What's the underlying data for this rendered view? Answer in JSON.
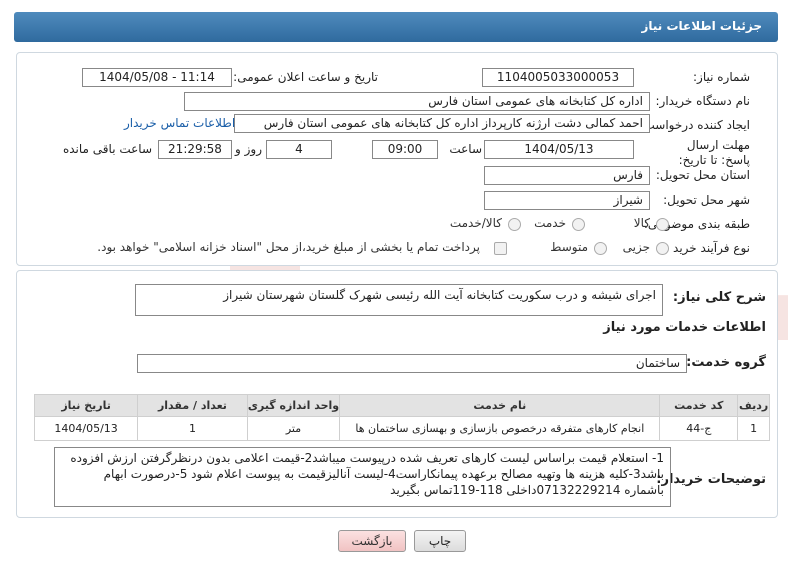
{
  "header": {
    "title": "جزئیات اطلاعات نیاز"
  },
  "fields": {
    "need_number_label": "شماره نیاز:",
    "need_number": "1104005033000053",
    "announce_label": "تاریخ و ساعت اعلان عمومی:",
    "announce_value": "1404/05/08 - 11:14",
    "buyer_label": "نام دستگاه خریدار:",
    "buyer_value": "اداره کل کتابخانه های عمومی استان فارس",
    "creator_label": "ایجاد کننده درخواست:",
    "creator_value": "احمد  کمالی دشت ارژنه  کارپرداز اداره کل کتابخانه های عمومی استان فارس",
    "buyer_contact_link": "اطلاعات تماس خریدار",
    "deadline_label": "مهلت ارسال پاسخ: تا تاریخ:",
    "deadline_date": "1404/05/13",
    "time_label": "ساعت",
    "deadline_time": "09:00",
    "days_value": "4",
    "days_label": "روز و",
    "remaining_time": "21:29:58",
    "remaining_label": "ساعت باقی مانده",
    "province_label": "استان محل تحویل:",
    "province_value": "فارس",
    "city_label": "شهر محل تحویل:",
    "city_value": "شیراز",
    "category_label": "طبقه بندی موضوعی:",
    "category_options": [
      "کالا",
      "خدمت",
      "کالا/خدمت"
    ],
    "purchase_type_label": "نوع فرآیند خرید :",
    "purchase_options": [
      "جزیی",
      "متوسط"
    ],
    "payment_note": "پرداخت تمام یا بخشی از مبلغ خرید،از محل \"اسناد خزانه اسلامی\" خواهد بود."
  },
  "section2": {
    "summary_label": "شرح کلی نیاز:",
    "summary_value": "اجرای شیشه و درب سکوریت کتابخانه آیت الله رئیسی شهرک گلستان شهرستان شیراز",
    "services_title": "اطلاعات خدمات مورد نیاز",
    "service_group_label": "گروه خدمت:",
    "service_group_value": "ساختمان"
  },
  "table": {
    "headers": [
      "ردیف",
      "کد خدمت",
      "نام خدمت",
      "واحد اندازه گیری",
      "تعداد / مقدار",
      "تاریخ نیاز"
    ],
    "rows": [
      [
        "1",
        "ج-44",
        "انجام کارهای متفرقه درخصوص بازسازی و بهسازی ساختمان ها",
        "متر",
        "1",
        "1404/05/13"
      ]
    ]
  },
  "notes": {
    "label": "توضیحات خریدار:",
    "text": "1- استعلام قیمت براساس لیست کارهای تعریف شده درپیوست میباشد2-قیمت اعلامی بدون درنظرگرفتن ارزش افزوده باشد3-کلیه هزینه ها وتهیه مصالح برعهده پیمانکاراست4-لیست آنالیزقیمت به پیوست اعلام شود 5-درصورت ابهام باشماره 07132229214داخلی 118-119تماس بگیرید"
  },
  "buttons": {
    "print": "چاپ",
    "back": "بازگشت"
  },
  "watermark": {
    "text": "AriaTender.neT"
  },
  "colors": {
    "header": "#3a76aa",
    "link": "#1a5ea8",
    "back_button": "#f1c3c3"
  }
}
